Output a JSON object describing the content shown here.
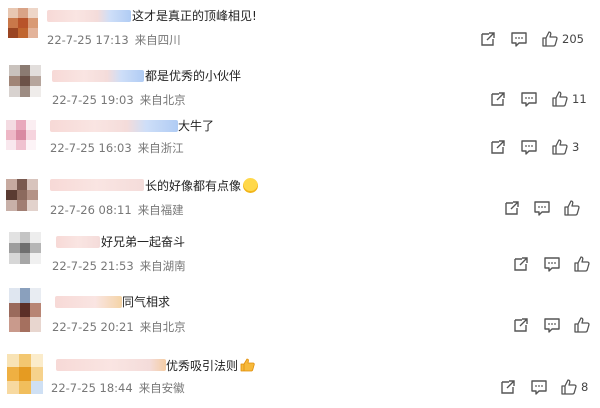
{
  "comments": [
    {
      "text": "这才是真正的顶峰相见!",
      "date": "22-7-25 17:13",
      "location": "来自四川",
      "likes": "205",
      "emoji": ""
    },
    {
      "text": "都是优秀的小伙伴",
      "date": "22-7-25 19:03",
      "location": "来自北京",
      "likes": "11",
      "emoji": ""
    },
    {
      "text": "大牛了",
      "date": "22-7-25 16:03",
      "location": "来自浙江",
      "likes": "3",
      "emoji": ""
    },
    {
      "text": "长的好像都有点像",
      "date": "22-7-26 08:11",
      "location": "来自福建",
      "likes": "",
      "emoji": "laughing-emoji"
    },
    {
      "text": "好兄弟一起奋斗",
      "date": "22-7-25 21:53",
      "location": "来自湖南",
      "likes": "",
      "emoji": ""
    },
    {
      "text": "同气相求",
      "date": "22-7-25 20:21",
      "location": "来自北京",
      "likes": "",
      "emoji": ""
    },
    {
      "text": "优秀吸引法则",
      "date": "22-7-25 18:44",
      "location": "来自安徽",
      "likes": "8",
      "emoji": "thumbs-up-emoji"
    }
  ],
  "icons": {
    "share": "share-icon",
    "comment": "comment-icon",
    "like": "like-icon"
  },
  "colors": {
    "meta_text": "#777777",
    "icon": "#555555",
    "background": "#ffffff"
  }
}
